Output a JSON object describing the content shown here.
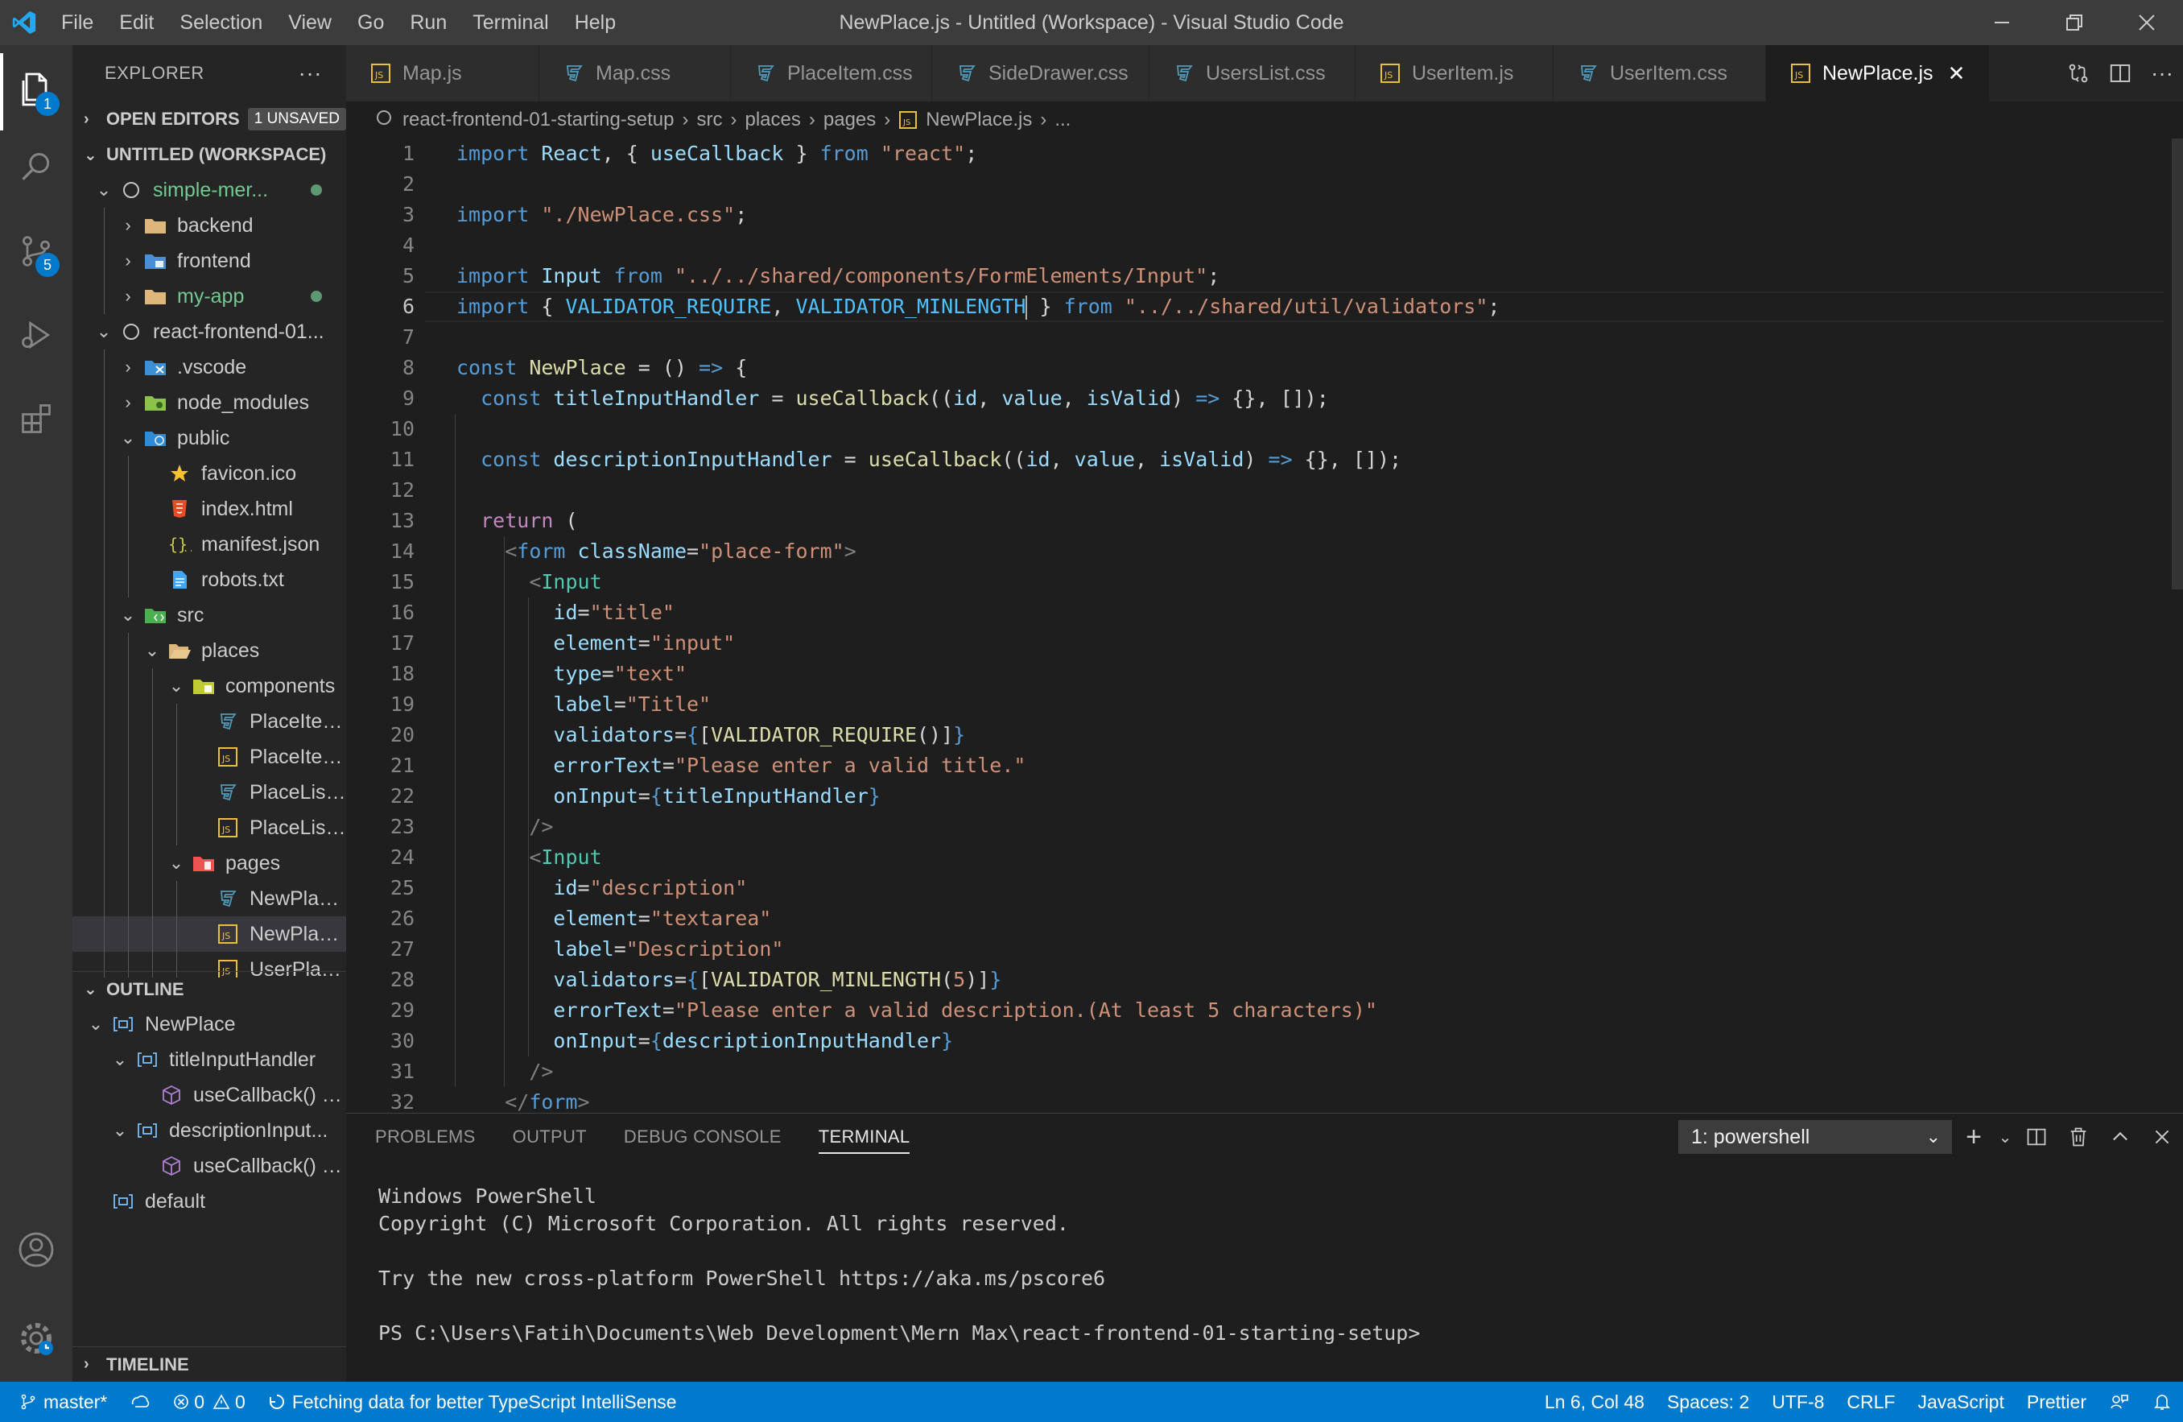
{
  "window": {
    "title": "NewPlace.js - Untitled (Workspace) - Visual Studio Code",
    "menu": [
      "File",
      "Edit",
      "Selection",
      "View",
      "Go",
      "Run",
      "Terminal",
      "Help"
    ]
  },
  "activity": {
    "explorer_badge": "1",
    "scm_badge": "5"
  },
  "sidebar": {
    "title": "EXPLORER",
    "more_label": "···",
    "open_editors": {
      "label": "OPEN EDITORS",
      "badge": "1 UNSAVED"
    },
    "workspace_label": "UNTITLED (WORKSPACE)",
    "tree": [
      {
        "label": "simple-mer...",
        "depth": 0,
        "chev": "⌄",
        "icon": "repo-icon",
        "green": true,
        "dot": true
      },
      {
        "label": "backend",
        "depth": 1,
        "chev": "›",
        "icon": "folder-icon"
      },
      {
        "label": "frontend",
        "depth": 1,
        "chev": "›",
        "icon": "folder-blue-icon"
      },
      {
        "label": "my-app",
        "depth": 1,
        "chev": "›",
        "icon": "folder-icon",
        "green": true,
        "dot": true
      },
      {
        "label": "react-frontend-01...",
        "depth": 0,
        "chev": "⌄",
        "icon": "repo-icon"
      },
      {
        "label": ".vscode",
        "depth": 1,
        "chev": "›",
        "icon": "folder-vscode-icon"
      },
      {
        "label": "node_modules",
        "depth": 1,
        "chev": "›",
        "icon": "folder-node-icon"
      },
      {
        "label": "public",
        "depth": 1,
        "chev": "⌄",
        "icon": "folder-public-icon"
      },
      {
        "label": "favicon.ico",
        "depth": 2,
        "icon": "star-icon"
      },
      {
        "label": "index.html",
        "depth": 2,
        "icon": "html-icon"
      },
      {
        "label": "manifest.json",
        "depth": 2,
        "icon": "json-icon"
      },
      {
        "label": "robots.txt",
        "depth": 2,
        "icon": "text-file-icon"
      },
      {
        "label": "src",
        "depth": 1,
        "chev": "⌄",
        "icon": "folder-src-icon"
      },
      {
        "label": "places",
        "depth": 2,
        "chev": "⌄",
        "icon": "folder-open-icon"
      },
      {
        "label": "components",
        "depth": 3,
        "chev": "⌄",
        "icon": "folder-components-icon"
      },
      {
        "label": "PlaceItem.css",
        "depth": 4,
        "icon": "css-icon"
      },
      {
        "label": "PlaceItem.js",
        "depth": 4,
        "icon": "js-icon"
      },
      {
        "label": "PlaceList.css",
        "depth": 4,
        "icon": "css-icon"
      },
      {
        "label": "PlaceList.js",
        "depth": 4,
        "icon": "js-icon"
      },
      {
        "label": "pages",
        "depth": 3,
        "chev": "⌄",
        "icon": "folder-pages-icon"
      },
      {
        "label": "NewPlace.css",
        "depth": 4,
        "icon": "css-icon"
      },
      {
        "label": "NewPlace.js",
        "depth": 4,
        "icon": "js-icon",
        "selected": true
      },
      {
        "label": "UserPlaces.js",
        "depth": 4,
        "icon": "js-icon"
      }
    ],
    "outline": {
      "label": "OUTLINE",
      "items": [
        {
          "label": "NewPlace",
          "depth": 0,
          "chev": "⌄",
          "icon": "variable-icon"
        },
        {
          "label": "titleInputHandler",
          "depth": 1,
          "chev": "⌄",
          "icon": "variable-icon"
        },
        {
          "label": "useCallback() ca...",
          "depth": 2,
          "icon": "method-icon"
        },
        {
          "label": "descriptionInput...",
          "depth": 1,
          "chev": "⌄",
          "icon": "variable-icon"
        },
        {
          "label": "useCallback() ca...",
          "depth": 2,
          "icon": "method-icon"
        },
        {
          "label": "default",
          "depth": 0,
          "icon": "variable-icon"
        }
      ]
    },
    "timeline_label": "TIMELINE"
  },
  "tabs": [
    {
      "label": "Map.js",
      "icon": "js-icon"
    },
    {
      "label": "Map.css",
      "icon": "css-icon"
    },
    {
      "label": "PlaceItem.css",
      "icon": "css-icon"
    },
    {
      "label": "SideDrawer.css",
      "icon": "css-icon"
    },
    {
      "label": "UsersList.css",
      "icon": "css-icon"
    },
    {
      "label": "UserItem.js",
      "icon": "js-icon"
    },
    {
      "label": "UserItem.css",
      "icon": "css-icon"
    },
    {
      "label": "NewPlace.js",
      "icon": "js-icon",
      "active": true
    }
  ],
  "breadcrumb": [
    "react-frontend-01-starting-setup",
    "src",
    "places",
    "pages",
    "NewPlace.js",
    "..."
  ],
  "editor": {
    "current_line": 6,
    "lines": [
      [
        [
          "kw",
          "import "
        ],
        [
          "var",
          "React"
        ],
        [
          "punc",
          ", { "
        ],
        [
          "var",
          "useCallback"
        ],
        [
          "punc",
          " } "
        ],
        [
          "kw",
          "from "
        ],
        [
          "str",
          "\"react\""
        ],
        [
          "punc",
          ";"
        ]
      ],
      [],
      [
        [
          "kw",
          "import "
        ],
        [
          "str",
          "\"./NewPlace.css\""
        ],
        [
          "punc",
          ";"
        ]
      ],
      [],
      [
        [
          "kw",
          "import "
        ],
        [
          "var",
          "Input"
        ],
        [
          "kw",
          " from "
        ],
        [
          "str",
          "\"../../shared/components/FormElements/Input\""
        ],
        [
          "punc",
          ";"
        ]
      ],
      [
        [
          "kw",
          "import "
        ],
        [
          "punc",
          "{ "
        ],
        [
          "const",
          "VALIDATOR_REQUIRE"
        ],
        [
          "punc",
          ", "
        ],
        [
          "const",
          "VALIDATOR_MINLENGTH"
        ],
        [
          "caret",
          ""
        ],
        [
          "punc",
          " } "
        ],
        [
          "kw",
          "from "
        ],
        [
          "str",
          "\"../../shared/util/validators\""
        ],
        [
          "punc",
          ";"
        ]
      ],
      [],
      [
        [
          "kw",
          "const "
        ],
        [
          "fn",
          "NewPlace"
        ],
        [
          "punc",
          " = () "
        ],
        [
          "kw",
          "=>"
        ],
        [
          "punc",
          " {"
        ]
      ],
      [
        [
          "punc",
          "  "
        ],
        [
          "kw",
          "const "
        ],
        [
          "var",
          "titleInputHandler"
        ],
        [
          "punc",
          " = "
        ],
        [
          "fn",
          "useCallback"
        ],
        [
          "punc",
          "(("
        ],
        [
          "var",
          "id"
        ],
        [
          "punc",
          ", "
        ],
        [
          "var",
          "value"
        ],
        [
          "punc",
          ", "
        ],
        [
          "var",
          "isValid"
        ],
        [
          "punc",
          ") "
        ],
        [
          "kw",
          "=>"
        ],
        [
          "punc",
          " {}, []);"
        ]
      ],
      [],
      [
        [
          "punc",
          "  "
        ],
        [
          "kw",
          "const "
        ],
        [
          "var",
          "descriptionInputHandler"
        ],
        [
          "punc",
          " = "
        ],
        [
          "fn",
          "useCallback"
        ],
        [
          "punc",
          "(("
        ],
        [
          "var",
          "id"
        ],
        [
          "punc",
          ", "
        ],
        [
          "var",
          "value"
        ],
        [
          "punc",
          ", "
        ],
        [
          "var",
          "isValid"
        ],
        [
          "punc",
          ") "
        ],
        [
          "kw",
          "=>"
        ],
        [
          "punc",
          " {}, []);"
        ]
      ],
      [],
      [
        [
          "punc",
          "  "
        ],
        [
          "ctl",
          "return"
        ],
        [
          "punc",
          " ("
        ]
      ],
      [
        [
          "punc",
          "    "
        ],
        [
          "tag",
          "<"
        ],
        [
          "kw",
          "form "
        ],
        [
          "var",
          "className"
        ],
        [
          "punc",
          "="
        ],
        [
          "str",
          "\"place-form\""
        ],
        [
          "tag",
          ">"
        ]
      ],
      [
        [
          "punc",
          "      "
        ],
        [
          "tag",
          "<"
        ],
        [
          "cls",
          "Input"
        ]
      ],
      [
        [
          "punc",
          "        "
        ],
        [
          "var",
          "id"
        ],
        [
          "punc",
          "="
        ],
        [
          "str",
          "\"title\""
        ]
      ],
      [
        [
          "punc",
          "        "
        ],
        [
          "var",
          "element"
        ],
        [
          "punc",
          "="
        ],
        [
          "str",
          "\"input\""
        ]
      ],
      [
        [
          "punc",
          "        "
        ],
        [
          "var",
          "type"
        ],
        [
          "punc",
          "="
        ],
        [
          "str",
          "\"text\""
        ]
      ],
      [
        [
          "punc",
          "        "
        ],
        [
          "var",
          "label"
        ],
        [
          "punc",
          "="
        ],
        [
          "str",
          "\"Title\""
        ]
      ],
      [
        [
          "punc",
          "        "
        ],
        [
          "var",
          "validators"
        ],
        [
          "punc",
          "="
        ],
        [
          "kw",
          "{"
        ],
        [
          "punc",
          "["
        ],
        [
          "fn",
          "VALIDATOR_REQUIRE"
        ],
        [
          "punc",
          "()]"
        ],
        [
          "kw",
          "}"
        ]
      ],
      [
        [
          "punc",
          "        "
        ],
        [
          "var",
          "errorText"
        ],
        [
          "punc",
          "="
        ],
        [
          "str",
          "\"Please enter a valid title.\""
        ]
      ],
      [
        [
          "punc",
          "        "
        ],
        [
          "var",
          "onInput"
        ],
        [
          "punc",
          "="
        ],
        [
          "kw",
          "{"
        ],
        [
          "var",
          "titleInputHandler"
        ],
        [
          "kw",
          "}"
        ]
      ],
      [
        [
          "punc",
          "      "
        ],
        [
          "tag",
          "/>"
        ]
      ],
      [
        [
          "punc",
          "      "
        ],
        [
          "tag",
          "<"
        ],
        [
          "cls",
          "Input"
        ]
      ],
      [
        [
          "punc",
          "        "
        ],
        [
          "var",
          "id"
        ],
        [
          "punc",
          "="
        ],
        [
          "str",
          "\"description\""
        ]
      ],
      [
        [
          "punc",
          "        "
        ],
        [
          "var",
          "element"
        ],
        [
          "punc",
          "="
        ],
        [
          "str",
          "\"textarea\""
        ]
      ],
      [
        [
          "punc",
          "        "
        ],
        [
          "var",
          "label"
        ],
        [
          "punc",
          "="
        ],
        [
          "str",
          "\"Description\""
        ]
      ],
      [
        [
          "punc",
          "        "
        ],
        [
          "var",
          "validators"
        ],
        [
          "punc",
          "="
        ],
        [
          "kw",
          "{"
        ],
        [
          "punc",
          "["
        ],
        [
          "fn",
          "VALIDATOR_MINLENGTH"
        ],
        [
          "punc",
          "("
        ],
        [
          "str",
          "5"
        ],
        [
          "punc",
          ")]"
        ],
        [
          "kw",
          "}"
        ]
      ],
      [
        [
          "punc",
          "        "
        ],
        [
          "var",
          "errorText"
        ],
        [
          "punc",
          "="
        ],
        [
          "str",
          "\"Please enter a valid description.(At least 5 characters)\""
        ]
      ],
      [
        [
          "punc",
          "        "
        ],
        [
          "var",
          "onInput"
        ],
        [
          "punc",
          "="
        ],
        [
          "kw",
          "{"
        ],
        [
          "var",
          "descriptionInputHandler"
        ],
        [
          "kw",
          "}"
        ]
      ],
      [
        [
          "punc",
          "      "
        ],
        [
          "tag",
          "/>"
        ]
      ],
      [
        [
          "punc",
          "    "
        ],
        [
          "tag",
          "</"
        ],
        [
          "kw",
          "form"
        ],
        [
          "tag",
          ">"
        ]
      ]
    ]
  },
  "panel": {
    "tabs": [
      "PROBLEMS",
      "OUTPUT",
      "DEBUG CONSOLE",
      "TERMINAL"
    ],
    "active_tab": "TERMINAL",
    "terminal_select": "1: powershell",
    "terminal_lines": [
      "Windows PowerShell",
      "Copyright (C) Microsoft Corporation. All rights reserved.",
      "",
      "Try the new cross-platform PowerShell https://aka.ms/pscore6",
      "",
      "PS C:\\Users\\Fatih\\Documents\\Web Development\\Mern Max\\react-frontend-01-starting-setup>"
    ]
  },
  "status": {
    "branch": "master*",
    "errors": "0",
    "warnings": "0",
    "message": "Fetching data for better TypeScript IntelliSense",
    "position": "Ln 6, Col 48",
    "spaces": "Spaces: 2",
    "encoding": "UTF-8",
    "eol": "CRLF",
    "language": "JavaScript",
    "formatter": "Prettier"
  },
  "colors": {
    "accent": "#007acc",
    "js": "#e8c13b",
    "css": "#519aba",
    "folder": "#dcb67a"
  }
}
